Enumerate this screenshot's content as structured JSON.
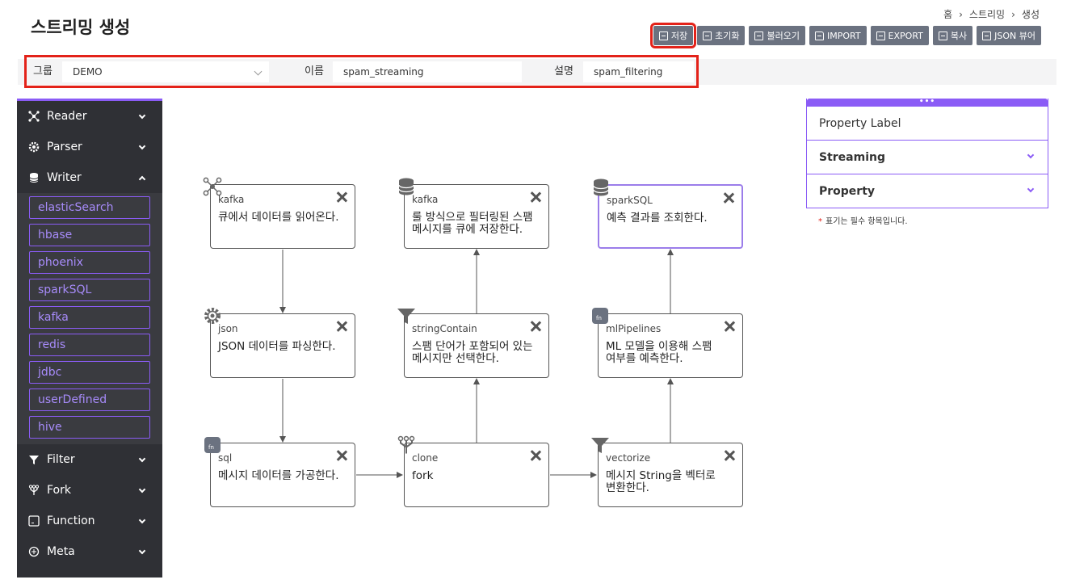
{
  "page": {
    "title": "스트리밍 생성"
  },
  "breadcrumb": [
    "홈",
    "스트리밍",
    "생성"
  ],
  "toolbar": {
    "save": "저장",
    "reset": "초기화",
    "load": "불러오기",
    "import": "IMPORT",
    "export": "EXPORT",
    "copy": "복사",
    "json_viewer": "JSON 뷰어"
  },
  "form": {
    "group_label": "그룹",
    "group_value": "DEMO",
    "name_label": "이름",
    "name_value": "spam_streaming",
    "desc_label": "설명",
    "desc_value": "spam_filtering"
  },
  "sidebar": {
    "categories": [
      {
        "label": "Reader",
        "icon": "network-icon"
      },
      {
        "label": "Parser",
        "icon": "gear-icon"
      },
      {
        "label": "Writer",
        "icon": "database-icon",
        "expanded": true
      },
      {
        "label": "Filter",
        "icon": "filter-icon"
      },
      {
        "label": "Fork",
        "icon": "fork-icon"
      },
      {
        "label": "Function",
        "icon": "function-icon"
      },
      {
        "label": "Meta",
        "icon": "meta-icon"
      }
    ],
    "writer_items": [
      "elasticSearch",
      "hbase",
      "phoenix",
      "sparkSQL",
      "kafka",
      "redis",
      "jdbc",
      "userDefined",
      "hive"
    ]
  },
  "nodes": {
    "n1": {
      "type": "kafka",
      "desc": "큐에서 데이터를 읽어온다.",
      "icon": "network-icon"
    },
    "n2": {
      "type": "json",
      "desc": "JSON 데이터를 파싱한다.",
      "icon": "gear-icon"
    },
    "n3": {
      "type": "sql",
      "desc": "메시지 데이터를 가공한다.",
      "icon": "function-icon"
    },
    "n4": {
      "type": "clone",
      "desc": "fork",
      "icon": "fork-icon"
    },
    "n5": {
      "type": "stringContain",
      "desc_l1": "스팸 단어가 포함되어 있는",
      "desc_l2": "메시지만 선택한다.",
      "icon": "filter-icon"
    },
    "n6": {
      "type": "kafka",
      "desc_l1": "룰 방식으로 필터링된 스팸",
      "desc_l2": "메시지를 큐에 저장한다.",
      "icon": "database-icon"
    },
    "n7": {
      "type": "vectorize",
      "desc_l1": "메시지 String을 벡터로",
      "desc_l2": "변환한다.",
      "icon": "filter-icon"
    },
    "n8": {
      "type": "mlPipelines",
      "desc_l1": "ML 모델을 이용해 스팸",
      "desc_l2": "여부를 예측한다.",
      "icon": "function-icon"
    },
    "n9": {
      "type": "sparkSQL",
      "desc": "예측 결과를 조회한다.",
      "icon": "database-icon"
    }
  },
  "panel": {
    "label": "Property Label",
    "streaming": "Streaming",
    "property": "Property",
    "note": "표기는 필수 항목입니다.",
    "note_star": "*"
  },
  "colors": {
    "accent": "#8b5cf6",
    "highlight": "#e32219",
    "sidebar_bg": "#2f3035",
    "button_bg": "#6b7280"
  }
}
